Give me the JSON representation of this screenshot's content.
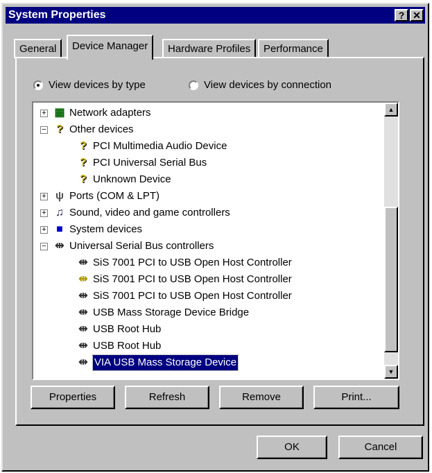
{
  "window": {
    "title": "System Properties",
    "help": "?",
    "close": "✕"
  },
  "tabs": [
    {
      "label": "General"
    },
    {
      "label": "Device Manager"
    },
    {
      "label": "Hardware Profiles"
    },
    {
      "label": "Performance"
    }
  ],
  "view": {
    "by_type": "View devices by type",
    "by_connection": "View devices by connection",
    "selected": "by_type"
  },
  "tree": [
    {
      "label": "Network adapters",
      "level": 0,
      "expander": "+",
      "icon": "network-icon"
    },
    {
      "label": "Other devices",
      "level": 0,
      "expander": "−",
      "icon": "question-icon"
    },
    {
      "label": "PCI Multimedia Audio Device",
      "level": 1,
      "icon": "warning-question-icon"
    },
    {
      "label": "PCI Universal Serial Bus",
      "level": 1,
      "icon": "warning-question-icon"
    },
    {
      "label": "Unknown Device",
      "level": 1,
      "icon": "warning-question-icon"
    },
    {
      "label": "Ports (COM & LPT)",
      "level": 0,
      "expander": "+",
      "icon": "port-icon"
    },
    {
      "label": "Sound, video and game controllers",
      "level": 0,
      "expander": "+",
      "icon": "sound-icon"
    },
    {
      "label": "System devices",
      "level": 0,
      "expander": "+",
      "icon": "computer-icon"
    },
    {
      "label": "Universal Serial Bus controllers",
      "level": 0,
      "expander": "−",
      "icon": "usb-icon"
    },
    {
      "label": "SiS 7001 PCI to USB Open Host Controller",
      "level": 1,
      "icon": "usb-icon"
    },
    {
      "label": "SiS 7001 PCI to USB Open Host Controller",
      "level": 1,
      "icon": "usb-warning-icon"
    },
    {
      "label": "SiS 7001 PCI to USB Open Host Controller",
      "level": 1,
      "icon": "usb-icon"
    },
    {
      "label": "USB Mass Storage Device Bridge",
      "level": 1,
      "icon": "usb-icon"
    },
    {
      "label": "USB Root Hub",
      "level": 1,
      "icon": "usb-icon"
    },
    {
      "label": "USB Root Hub",
      "level": 1,
      "icon": "usb-icon"
    },
    {
      "label": "VIA USB Mass Storage Device",
      "level": 1,
      "icon": "usb-icon",
      "selected": true
    }
  ],
  "buttons": {
    "properties": "Properties",
    "refresh": "Refresh",
    "remove": "Remove",
    "print": "Print...",
    "ok": "OK",
    "cancel": "Cancel"
  }
}
